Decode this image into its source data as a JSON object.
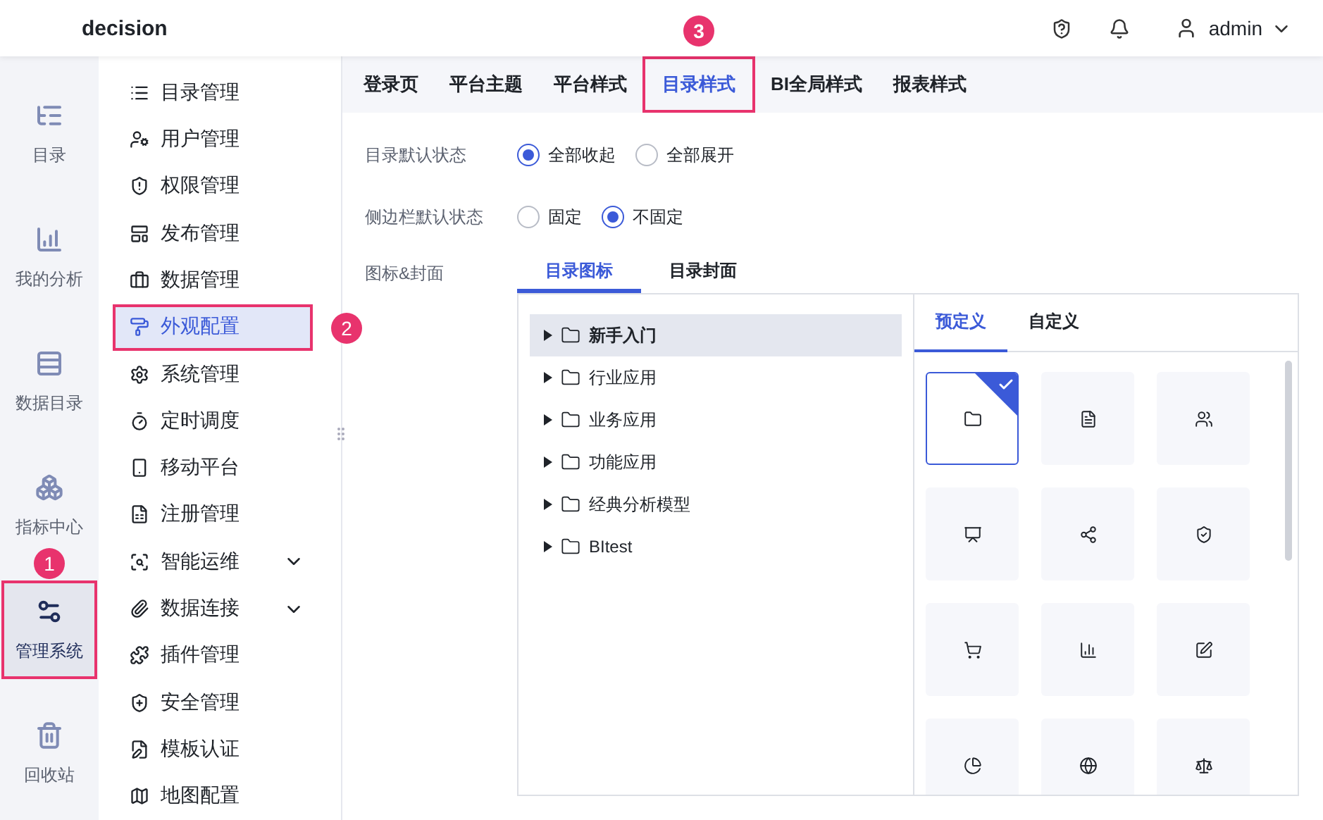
{
  "header": {
    "title": "decision",
    "user": "admin"
  },
  "rail": [
    {
      "label": "目录",
      "selected": false
    },
    {
      "label": "我的分析",
      "selected": false
    },
    {
      "label": "数据目录",
      "selected": false
    },
    {
      "label": "指标中心",
      "selected": false
    },
    {
      "label": "管理系统",
      "selected": true,
      "callout": "1"
    },
    {
      "label": "回收站",
      "selected": false
    }
  ],
  "menu": [
    {
      "label": "目录管理",
      "selected": false
    },
    {
      "label": "用户管理",
      "selected": false
    },
    {
      "label": "权限管理",
      "selected": false
    },
    {
      "label": "发布管理",
      "selected": false
    },
    {
      "label": "数据管理",
      "selected": false
    },
    {
      "label": "外观配置",
      "selected": true,
      "callout": "2"
    },
    {
      "label": "系统管理",
      "selected": false
    },
    {
      "label": "定时调度",
      "selected": false
    },
    {
      "label": "移动平台",
      "selected": false
    },
    {
      "label": "注册管理",
      "selected": false
    },
    {
      "label": "智能运维",
      "selected": false,
      "expandable": true
    },
    {
      "label": "数据连接",
      "selected": false,
      "expandable": true
    },
    {
      "label": "插件管理",
      "selected": false
    },
    {
      "label": "安全管理",
      "selected": false
    },
    {
      "label": "模板认证",
      "selected": false
    },
    {
      "label": "地图配置",
      "selected": false
    }
  ],
  "tabs": [
    {
      "label": "登录页",
      "selected": false
    },
    {
      "label": "平台主题",
      "selected": false
    },
    {
      "label": "平台样式",
      "selected": false
    },
    {
      "label": "目录样式",
      "selected": true,
      "callout": "3"
    },
    {
      "label": "BI全局样式",
      "selected": false
    },
    {
      "label": "报表样式",
      "selected": false
    }
  ],
  "settings": [
    {
      "label": "目录默认状态",
      "options": [
        {
          "label": "全部收起",
          "selected": true
        },
        {
          "label": "全部展开",
          "selected": false
        }
      ]
    },
    {
      "label": "侧边栏默认状态",
      "options": [
        {
          "label": "固定",
          "selected": false
        },
        {
          "label": "不固定",
          "selected": true
        }
      ]
    }
  ],
  "icon_cover": {
    "label": "图标&封面",
    "tabs": [
      {
        "label": "目录图标",
        "selected": true
      },
      {
        "label": "目录封面",
        "selected": false
      }
    ],
    "tree": [
      {
        "label": "新手入门",
        "selected": true
      },
      {
        "label": "行业应用",
        "selected": false
      },
      {
        "label": "业务应用",
        "selected": false
      },
      {
        "label": "功能应用",
        "selected": false
      },
      {
        "label": "经典分析模型",
        "selected": false
      },
      {
        "label": "BItest",
        "selected": false
      }
    ],
    "icon_tabs": [
      {
        "label": "预定义",
        "selected": true
      },
      {
        "label": "自定义",
        "selected": false
      }
    ],
    "icons": [
      {
        "selected": true
      },
      {
        "selected": false
      },
      {
        "selected": false
      },
      {
        "selected": false
      },
      {
        "selected": false
      },
      {
        "selected": false
      },
      {
        "selected": false
      },
      {
        "selected": false
      },
      {
        "selected": false
      },
      {
        "selected": false
      },
      {
        "selected": false
      },
      {
        "selected": false
      }
    ]
  }
}
